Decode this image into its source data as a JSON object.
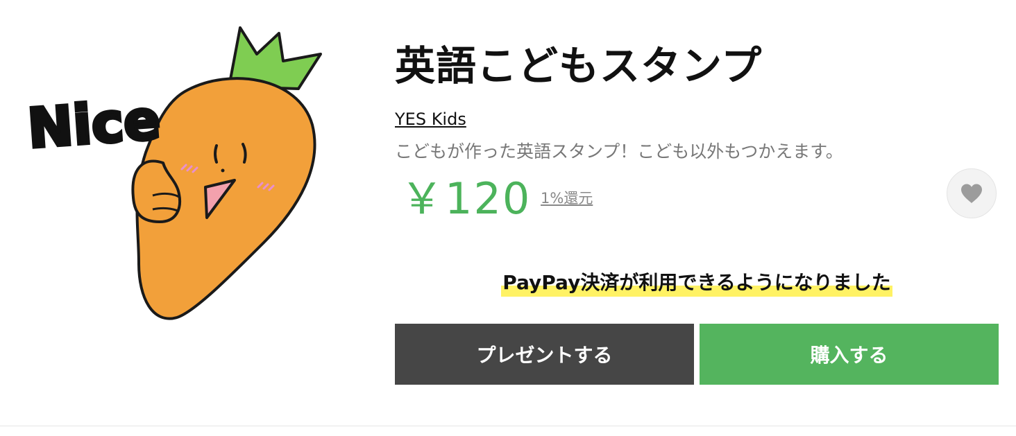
{
  "sticker": {
    "image_text": "Nice",
    "icon": "carrot-thumbs-up-sticker"
  },
  "product": {
    "title": "英語こどもスタンプ",
    "author": "YES Kids",
    "description": "こどもが作った英語スタンプ！こども以外もつかえます。",
    "price": "￥120",
    "reward": "1%還元"
  },
  "notice": {
    "text": "PayPay決済が利用できるようになりました"
  },
  "actions": {
    "present_label": "プレゼントする",
    "buy_label": "購入する"
  },
  "colors": {
    "price": "#4cb35b",
    "buy_button": "#54b45e",
    "present_button": "#464646",
    "highlight": "#fff264",
    "favorite_icon": "#9c9c9c"
  }
}
